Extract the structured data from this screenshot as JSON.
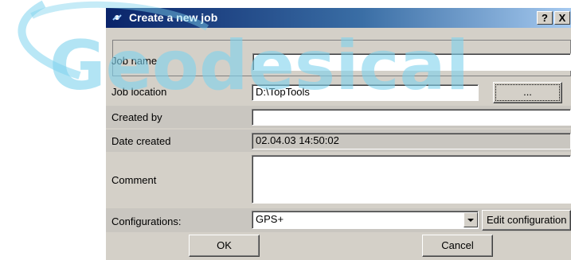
{
  "dialog": {
    "title": "Create a new job",
    "help_glyph": "?",
    "close_glyph": "X",
    "icons": {
      "app": "satellite-icon",
      "help": "help-icon",
      "close": "close-icon"
    }
  },
  "form": {
    "job_name": {
      "label": "Job name",
      "value": ""
    },
    "job_location": {
      "label": "Job location",
      "value": "D:\\TopTools",
      "browse_label": "..."
    },
    "created_by": {
      "label": "Created by",
      "value": ""
    },
    "date_created": {
      "label": "Date created",
      "value": "02.04.03 14:50:02"
    },
    "comment": {
      "label": "Comment",
      "value": ""
    },
    "configurations": {
      "label": "Configurations:",
      "selected": "GPS+",
      "edit_label": "Edit configuration"
    }
  },
  "buttons": {
    "ok": "OK",
    "cancel": "Cancel"
  },
  "watermark": {
    "text": "Geodesical"
  },
  "colors": {
    "titlebar": "#0a246a",
    "watermark": "#7fd3ee"
  }
}
